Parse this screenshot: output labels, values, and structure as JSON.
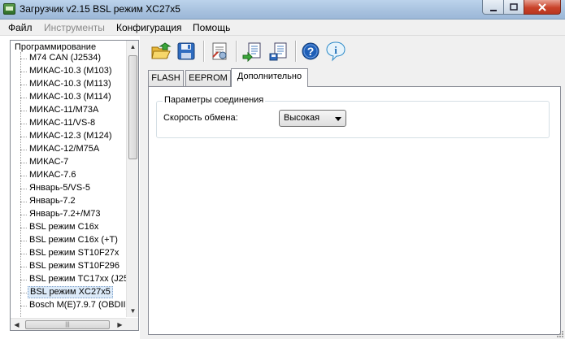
{
  "window": {
    "title": "Загрузчик v2.15 BSL режим XC27x5",
    "min_icon": "minimize-icon",
    "max_icon": "maximize-icon",
    "close_icon": "close-icon"
  },
  "menu": [
    {
      "label": "Файл",
      "enabled": true
    },
    {
      "label": "Инструменты",
      "enabled": false
    },
    {
      "label": "Конфигурация",
      "enabled": true
    },
    {
      "label": "Помощь",
      "enabled": true
    }
  ],
  "tree": {
    "root": "Программирование",
    "items": [
      "M74 CAN (J2534)",
      "МИКАС-10.3 (M103)",
      "МИКАС-10.3 (M113)",
      "МИКАС-10.3 (M114)",
      "МИКАС-11/M73A",
      "МИКАС-11/VS-8",
      "МИКАС-12.3 (M124)",
      "МИКАС-12/M75A",
      "МИКАС-7",
      "МИКАС-7.6",
      "Январь-5/VS-5",
      "Январь-7.2",
      "Январь-7.2+/M73",
      "BSL режим C16x",
      "BSL режим C16x (+T)",
      "BSL режим ST10F27x",
      "BSL режим ST10F296",
      "BSL режим TC17xx (J25",
      "BSL режим XC27x5",
      "Bosch M(E)7.9.7 (OBDII)"
    ],
    "selected_index": 18
  },
  "toolbar": {
    "buttons": [
      "open-folder-icon",
      "save-disk-icon",
      "settings-document-icon",
      "read-ecu-icon",
      "write-ecu-icon",
      "help-icon",
      "info-icon"
    ]
  },
  "tabs": [
    {
      "label": "FLASH",
      "active": false
    },
    {
      "label": "EEPROM",
      "active": false
    },
    {
      "label": "Дополнительно",
      "active": true
    }
  ],
  "connection": {
    "group_title": "Параметры соединения",
    "speed_label": "Скорость обмена:",
    "speed_value": "Высокая"
  },
  "colors": {
    "selection": "#dceaf8",
    "close_button": "#c9432a",
    "help_blue": "#1f5fb7"
  }
}
